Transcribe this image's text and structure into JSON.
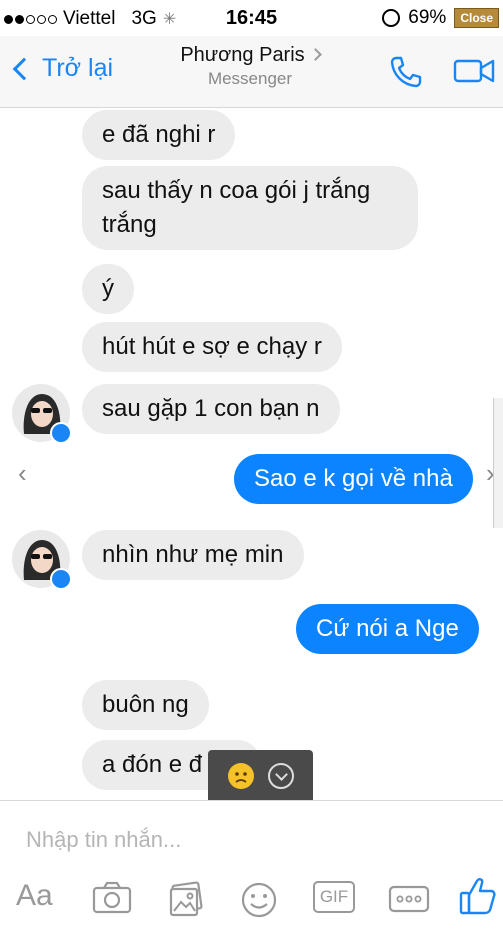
{
  "status_bar": {
    "carrier": "Viettel",
    "network": "3G",
    "time": "16:45",
    "battery": "69%",
    "close_label": "Close"
  },
  "header": {
    "back_label": "Trở lại",
    "contact_name": "Phương Paris",
    "subtitle": "Messenger",
    "accent_color": "#1a86f5"
  },
  "messages": [
    {
      "side": "in",
      "text": "e đã nghi r"
    },
    {
      "side": "in",
      "text": "sau thấy n coa gói j trắng trắng"
    },
    {
      "side": "in",
      "text": "ý"
    },
    {
      "side": "in",
      "text": "hút hút e sợ e chạy r"
    },
    {
      "side": "in",
      "text": "sau gặp 1 con bạn n"
    },
    {
      "side": "out",
      "text": "Sao e k gọi về nhà"
    },
    {
      "side": "in",
      "text": "nhìn như mẹ min"
    },
    {
      "side": "out",
      "text": "Cứ nói a Nge"
    },
    {
      "side": "in",
      "text": "buôn ng"
    },
    {
      "side": "in",
      "text": "a đón e đ"
    }
  ],
  "composer": {
    "placeholder": "Nhập tin nhắn...",
    "aa_label": "Aa",
    "gif_label": "GIF",
    "icons": [
      "camera-icon",
      "gallery-icon",
      "emoji-icon",
      "gif-icon",
      "more-icon",
      "like-icon"
    ]
  },
  "colors": {
    "outgoing_bubble": "#0d84ff",
    "incoming_bubble": "#ececec"
  }
}
